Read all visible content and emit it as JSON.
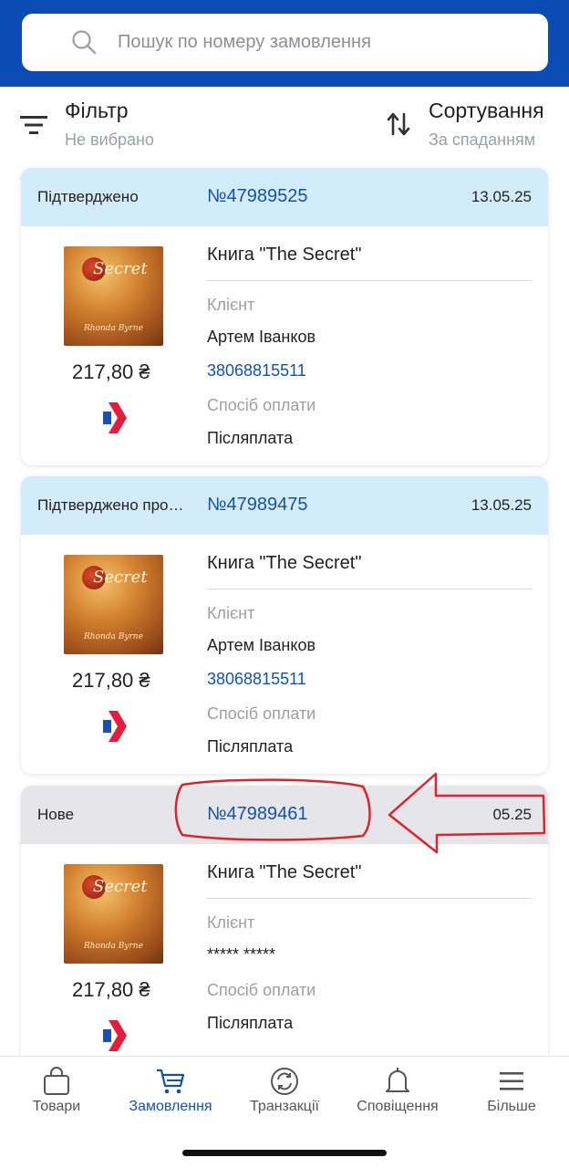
{
  "search": {
    "placeholder": "Пошук по номеру замовлення"
  },
  "controls": {
    "filter_label": "Фільтр",
    "filter_value": "Не вибрано",
    "sort_label": "Сортування",
    "sort_value": "За спаданням"
  },
  "orders": [
    {
      "status": "Підтверджено",
      "number": "№47989525",
      "date": "13.05.25",
      "price": "217,80 ₴",
      "product": "Книга \"The Secret\"",
      "client_label": "Клієнт",
      "client_name": "Артем Іванков",
      "client_phone": "38068815511",
      "payment_label": "Спосіб оплати",
      "payment": "Післяплата",
      "head_color": "#d3ecfb"
    },
    {
      "status": "Підтверджено про…",
      "number": "№47989475",
      "date": "13.05.25",
      "price": "217,80 ₴",
      "product": "Книга \"The Secret\"",
      "client_label": "Клієнт",
      "client_name": "Артем Іванков",
      "client_phone": "38068815511",
      "payment_label": "Спосіб оплати",
      "payment": "Післяплата",
      "head_color": "#d3ecfb"
    },
    {
      "status": "Нове",
      "number": "№47989461",
      "date": "05.25",
      "price": "217,80 ₴",
      "product": "Книга \"The Secret\"",
      "client_label": "Клієнт",
      "client_name": "***** *****",
      "payment_label": "Спосіб оплати",
      "payment": "Післяплата",
      "head_color": "#e6e6ea"
    }
  ],
  "cover": {
    "word": "Secret",
    "author": "Rhonda Byrne"
  },
  "tabs": [
    {
      "label": "Товари",
      "icon": "bag-icon"
    },
    {
      "label": "Замовлення",
      "icon": "cart-icon",
      "active": true
    },
    {
      "label": "Транзакції",
      "icon": "sync-icon"
    },
    {
      "label": "Сповіщення",
      "icon": "bell-icon"
    },
    {
      "label": "Більше",
      "icon": "menu-icon"
    }
  ],
  "colors": {
    "brand": "#0b4bb3",
    "link": "#1452a8",
    "annotation": "#d9262c"
  }
}
